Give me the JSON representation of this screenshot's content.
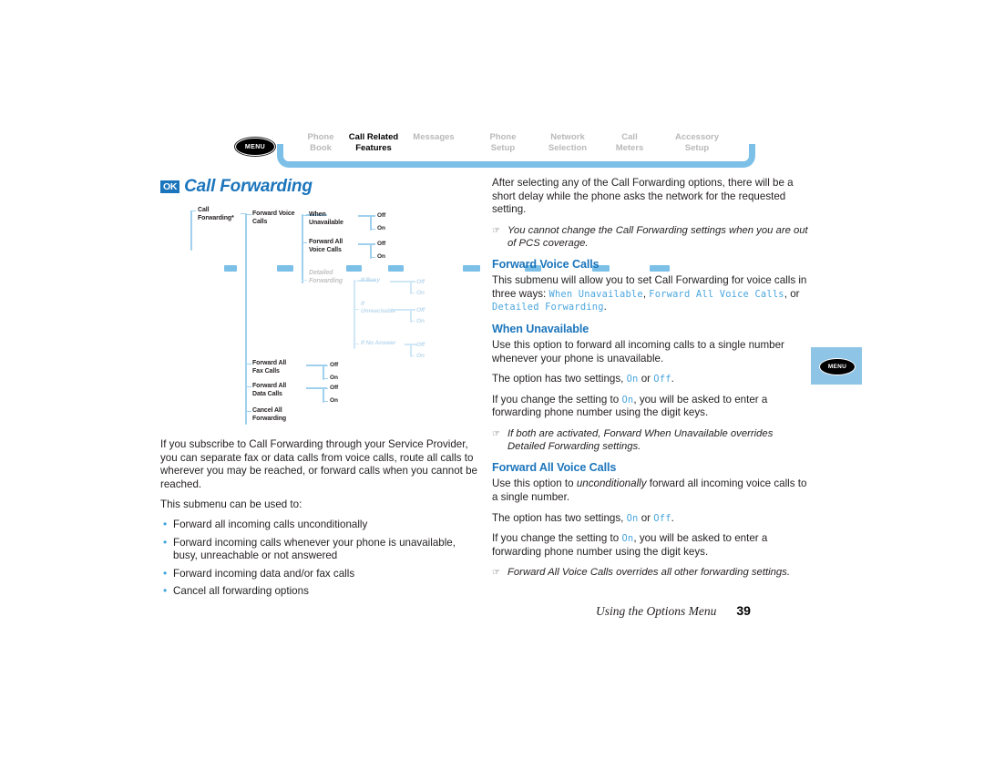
{
  "nav": {
    "menu_button_label": "MENU",
    "items": [
      {
        "label": "Phone\nBook",
        "active": false
      },
      {
        "label": "Call Related\nFeatures",
        "active": true
      },
      {
        "label": "Messages",
        "active": false
      },
      {
        "label": "Phone\nSetup",
        "active": false
      },
      {
        "label": "Network\nSelection",
        "active": false
      },
      {
        "label": "Call\nMeters",
        "active": false
      },
      {
        "label": "Accessory\nSetup",
        "active": false
      }
    ]
  },
  "title": {
    "badge": "OK",
    "text": "Call Forwarding"
  },
  "tree": {
    "root": "Call\nForwarding*",
    "level1": [
      "Forward Voice\nCalls",
      "Forward All\nFax Calls",
      "Forward All\nData Calls",
      "Cancel All\nForwarding"
    ],
    "voice_children": [
      "When\nUnavailable",
      "Forward All\nVoice Calls",
      "Detailed\nForwarding"
    ],
    "detailed_children": [
      "If Busy",
      "If\nUnreachable",
      "If No Answer"
    ],
    "toggle_off": "Off",
    "toggle_on": "On"
  },
  "left_column": {
    "intro": "If you subscribe to Call Forwarding through your Service Provider, you can separate fax or data calls from voice calls, route all calls to wherever you may be reached, or forward calls when you cannot be reached.",
    "submenu_lead": "This submenu can be used to:",
    "bullets": [
      "Forward all incoming calls unconditionally",
      "Forward incoming calls whenever your phone is unavailable, busy, unreachable or not answered",
      "Forward incoming data and/or fax calls",
      "Cancel all forwarding options"
    ]
  },
  "right_column": {
    "intro": "After selecting any of the Call Forwarding options, there will be a short delay while the phone asks the network for the requested setting.",
    "note_1": "You cannot change the Call Forwarding settings when you are out of PCS coverage.",
    "heading_forward_voice": "Forward Voice Calls",
    "forward_voice_text_a": "This submenu will allow you to set Call Forwarding for voice calls in three ways: ",
    "lcd_when_unavailable": "When Unavailable",
    "forward_voice_sep1": ", ",
    "lcd_forward_all_voice": "Forward All Voice Calls",
    "forward_voice_sep2": ", or ",
    "lcd_detailed_forwarding": "Detailed Forwarding",
    "forward_voice_text_end": ".",
    "heading_when_unavailable": "When Unavailable",
    "when_unavailable_text": "Use this option to forward all incoming calls to a single number whenever your phone is unavailable.",
    "settings_lead": "The option has two settings, ",
    "lcd_on": "On",
    "settings_or": " or ",
    "lcd_off": "Off",
    "settings_end": ".",
    "change_lead": "If you change the setting to ",
    "change_end": ", you will be asked to enter a forwarding phone number using the digit keys.",
    "note_2": "If both are activated, Forward When Unavailable overrides Detailed Forwarding settings.",
    "heading_forward_all_voice": "Forward All Voice Calls",
    "forward_all_a": "Use this option to ",
    "forward_all_em": "unconditionally",
    "forward_all_b": " forward all incoming voice calls to a single number.",
    "note_3": "Forward All Voice Calls overrides all other forwarding settings."
  },
  "footer": {
    "title": "Using the Options Menu",
    "page": "39"
  },
  "side_tab": {
    "label": "MENU"
  },
  "icons": {
    "hand": "☞"
  },
  "colors": {
    "accent_blue": "#1b75bc",
    "lcd_blue": "#4aa6dd",
    "line_blue": "#9fd0ee",
    "nav_blue": "#7cc0e8",
    "tab_blue": "#8ec4e6"
  }
}
